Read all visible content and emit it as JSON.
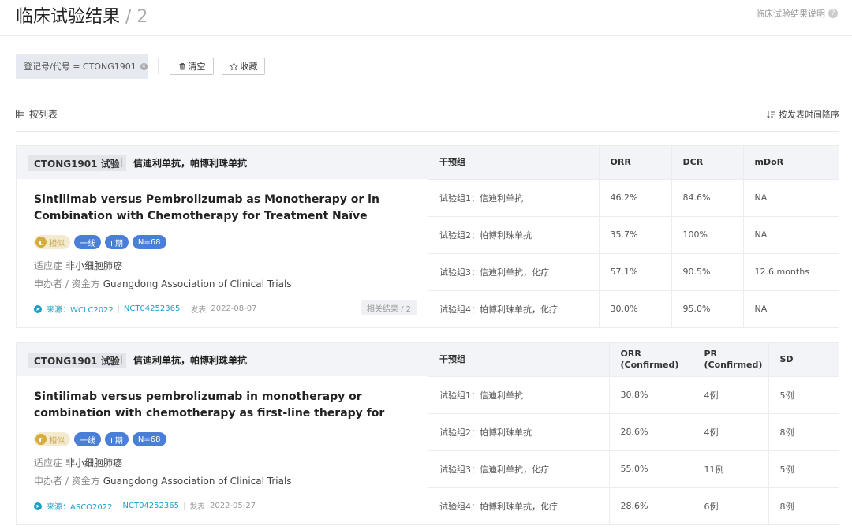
{
  "header": {
    "title": "临床试验结果",
    "count": "/ 2",
    "help_text": "临床试验结果说明",
    "help_icon": "question-icon"
  },
  "filter": {
    "chip_label": "登记号/代号 = CTONG1901",
    "clear_label": "清空",
    "favorite_label": "收藏"
  },
  "view": {
    "mode_label": "按列表",
    "sort_label": "按发表时间降序"
  },
  "cards": [
    {
      "trial_tag": "CTONG1901 试验",
      "drugs": "信迪利单抗，帕博利珠单抗",
      "title": "Sintilimab versus Pembrolizumab as Monotherapy or in Combination with Chemotherapy for Treatment Naïve Metastatic Non-small Cell...",
      "tags": {
        "similar": "相似",
        "line": "一线",
        "phase": "II期",
        "n": "N=68"
      },
      "indication_label": "适应症",
      "indication": "非小细胞肺癌",
      "sponsor_label": "申办者 / 资金方",
      "sponsor": "Guangdong Association of Clinical Trials",
      "source_label": "来源：WCLC2022",
      "nct": "NCT04252365",
      "published_label": "发表",
      "published": "2022-08-07",
      "related": "相关结果 / 2",
      "table": {
        "headers": [
          "干预组",
          "ORR",
          "DCR",
          "mDoR"
        ],
        "rows": [
          [
            "试验组1：信迪利单抗",
            "46.2%",
            "84.6%",
            "NA"
          ],
          [
            "试验组2：帕博利珠单抗",
            "35.7%",
            "100%",
            "NA"
          ],
          [
            "试验组3：信迪利单抗，化疗",
            "57.1%",
            "90.5%",
            "12.6 months"
          ],
          [
            "试验组4：帕博利珠单抗，化疗",
            "30.0%",
            "95.0%",
            "NA"
          ]
        ]
      }
    },
    {
      "trial_tag": "CTONG1901 试验",
      "drugs": "信迪利单抗，帕博利珠单抗",
      "title": "Sintilimab versus pembrolizumab in monotherapy or combination with chemotherapy as first-line therapy for advanced non–small cell lung...",
      "tags": {
        "similar": "相似",
        "line": "一线",
        "phase": "II期",
        "n": "N=68"
      },
      "indication_label": "适应症",
      "indication": "非小细胞肺癌",
      "sponsor_label": "申办者 / 资金方",
      "sponsor": "Guangdong Association of Clinical Trials",
      "source_label": "来源：ASCO2022",
      "nct": "NCT04252365",
      "published_label": "发表",
      "published": "2022-05-27",
      "table": {
        "headers": [
          "干预组",
          "ORR (Confirmed)",
          "PR (Confirmed)",
          "SD"
        ],
        "rows": [
          [
            "试验组1：信迪利单抗",
            "30.8%",
            "4例",
            "5例"
          ],
          [
            "试验组2：帕博利珠单抗",
            "28.6%",
            "4例",
            "8例"
          ],
          [
            "试验组3：信迪利单抗，化疗",
            "55.0%",
            "11例",
            "5例"
          ],
          [
            "试验组4：帕博利珠单抗，化疗",
            "28.6%",
            "6例",
            "8例"
          ]
        ]
      }
    }
  ]
}
